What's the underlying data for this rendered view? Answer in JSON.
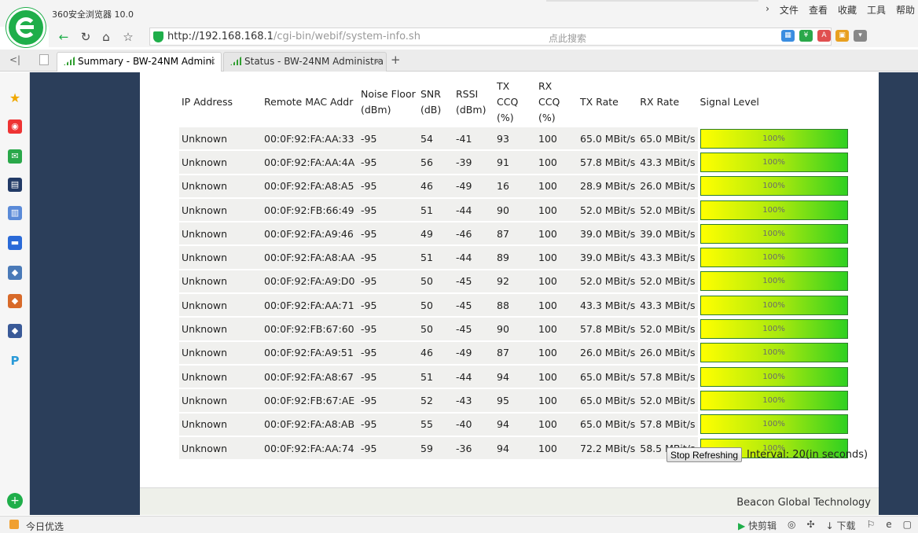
{
  "browser": {
    "title": "360安全浏览器 10.0",
    "menus": [
      "文件",
      "查看",
      "收藏",
      "工具",
      "帮助"
    ],
    "url_host": "http://192.168.168.1",
    "url_path": "/cgi-bin/webif/system-info.sh",
    "search_placeholder": "点此搜索",
    "tabs": [
      {
        "label": "Summary - BW-24NM Admini",
        "active": true
      },
      {
        "label": "Status - BW-24NM Administra",
        "active": false
      }
    ],
    "status_left": "今日优选",
    "status_right": [
      "快剪辑",
      "下载"
    ]
  },
  "table": {
    "headers": {
      "ip": "IP Address",
      "mac": "Remote MAC Addr",
      "noise1": "Noise Floor",
      "noise2": "(dBm)",
      "snr1": "SNR",
      "snr2": "(dB)",
      "rssi1": "RSSI",
      "rssi2": "(dBm)",
      "txccq1": "TX CCQ",
      "txccq2": "(%)",
      "rxccq1": "RX CCQ",
      "rxccq2": "(%)",
      "txrate": "TX Rate",
      "rxrate": "RX Rate",
      "signal": "Signal Level"
    },
    "rows": [
      {
        "ip": "Unknown",
        "mac": "00:0F:92:FA:AA:33",
        "noise": "-95",
        "snr": "54",
        "rssi": "-41",
        "txccq": "93",
        "rxccq": "100",
        "txrate": "65.0 MBit/s",
        "rxrate": "65.0 MBit/s",
        "signal": "100%"
      },
      {
        "ip": "Unknown",
        "mac": "00:0F:92:FA:AA:4A",
        "noise": "-95",
        "snr": "56",
        "rssi": "-39",
        "txccq": "91",
        "rxccq": "100",
        "txrate": "57.8 MBit/s",
        "rxrate": "43.3 MBit/s",
        "signal": "100%"
      },
      {
        "ip": "Unknown",
        "mac": "00:0F:92:FA:A8:A5",
        "noise": "-95",
        "snr": "46",
        "rssi": "-49",
        "txccq": "16",
        "rxccq": "100",
        "txrate": "28.9 MBit/s",
        "rxrate": "26.0 MBit/s",
        "signal": "100%"
      },
      {
        "ip": "Unknown",
        "mac": "00:0F:92:FB:66:49",
        "noise": "-95",
        "snr": "51",
        "rssi": "-44",
        "txccq": "90",
        "rxccq": "100",
        "txrate": "52.0 MBit/s",
        "rxrate": "52.0 MBit/s",
        "signal": "100%"
      },
      {
        "ip": "Unknown",
        "mac": "00:0F:92:FA:A9:46",
        "noise": "-95",
        "snr": "49",
        "rssi": "-46",
        "txccq": "87",
        "rxccq": "100",
        "txrate": "39.0 MBit/s",
        "rxrate": "39.0 MBit/s",
        "signal": "100%"
      },
      {
        "ip": "Unknown",
        "mac": "00:0F:92:FA:A8:AA",
        "noise": "-95",
        "snr": "51",
        "rssi": "-44",
        "txccq": "89",
        "rxccq": "100",
        "txrate": "39.0 MBit/s",
        "rxrate": "43.3 MBit/s",
        "signal": "100%"
      },
      {
        "ip": "Unknown",
        "mac": "00:0F:92:FA:A9:D0",
        "noise": "-95",
        "snr": "50",
        "rssi": "-45",
        "txccq": "92",
        "rxccq": "100",
        "txrate": "52.0 MBit/s",
        "rxrate": "52.0 MBit/s",
        "signal": "100%"
      },
      {
        "ip": "Unknown",
        "mac": "00:0F:92:FA:AA:71",
        "noise": "-95",
        "snr": "50",
        "rssi": "-45",
        "txccq": "88",
        "rxccq": "100",
        "txrate": "43.3 MBit/s",
        "rxrate": "43.3 MBit/s",
        "signal": "100%"
      },
      {
        "ip": "Unknown",
        "mac": "00:0F:92:FB:67:60",
        "noise": "-95",
        "snr": "50",
        "rssi": "-45",
        "txccq": "90",
        "rxccq": "100",
        "txrate": "57.8 MBit/s",
        "rxrate": "52.0 MBit/s",
        "signal": "100%"
      },
      {
        "ip": "Unknown",
        "mac": "00:0F:92:FA:A9:51",
        "noise": "-95",
        "snr": "46",
        "rssi": "-49",
        "txccq": "87",
        "rxccq": "100",
        "txrate": "26.0 MBit/s",
        "rxrate": "26.0 MBit/s",
        "signal": "100%"
      },
      {
        "ip": "Unknown",
        "mac": "00:0F:92:FA:A8:67",
        "noise": "-95",
        "snr": "51",
        "rssi": "-44",
        "txccq": "94",
        "rxccq": "100",
        "txrate": "65.0 MBit/s",
        "rxrate": "57.8 MBit/s",
        "signal": "100%"
      },
      {
        "ip": "Unknown",
        "mac": "00:0F:92:FB:67:AE",
        "noise": "-95",
        "snr": "52",
        "rssi": "-43",
        "txccq": "95",
        "rxccq": "100",
        "txrate": "65.0 MBit/s",
        "rxrate": "52.0 MBit/s",
        "signal": "100%"
      },
      {
        "ip": "Unknown",
        "mac": "00:0F:92:FA:A8:AB",
        "noise": "-95",
        "snr": "55",
        "rssi": "-40",
        "txccq": "94",
        "rxccq": "100",
        "txrate": "65.0 MBit/s",
        "rxrate": "57.8 MBit/s",
        "signal": "100%"
      },
      {
        "ip": "Unknown",
        "mac": "00:0F:92:FA:AA:74",
        "noise": "-95",
        "snr": "59",
        "rssi": "-36",
        "txccq": "94",
        "rxccq": "100",
        "txrate": "72.2 MBit/s",
        "rxrate": "58.5 MBit/s",
        "signal": "100%"
      }
    ]
  },
  "controls": {
    "stop_label": "Stop Refreshing",
    "interval_text": "Interval: 20(in seconds)"
  },
  "footer": {
    "company": "Beacon Global Technology"
  },
  "colors": {
    "sidebar": "#2b3e5a",
    "meter_start": "#ffff00",
    "meter_end": "#2fd021",
    "brand_green": "#1fae4a"
  }
}
